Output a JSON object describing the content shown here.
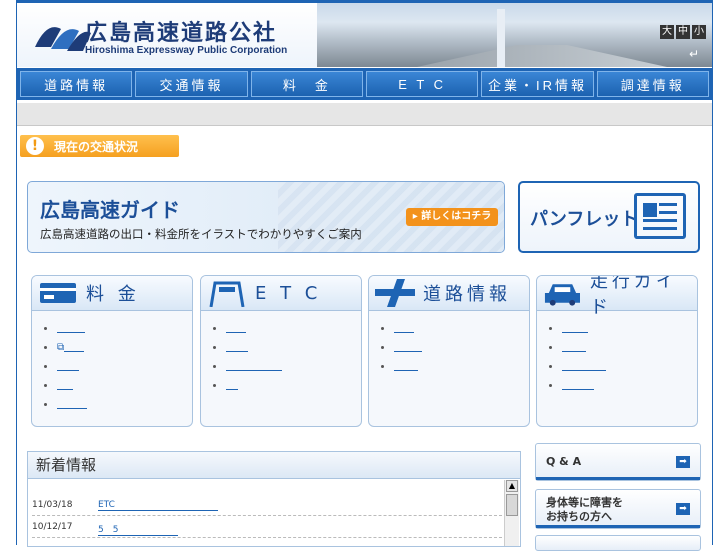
{
  "header": {
    "title_jp": "広島高速道路公社",
    "title_en": "Hiroshima Expressway Public Corporation",
    "size_controls": [
      "大",
      "中",
      "小"
    ],
    "enter_icon": "return-arrow-icon"
  },
  "nav": {
    "items": [
      "道路情報",
      "交通情報",
      "料　金",
      "E T C",
      "企業・IR情報",
      "調達情報"
    ]
  },
  "traffic": {
    "label": "現在の交通状況",
    "icon": "!"
  },
  "guide": {
    "title": "広島高速ガイド",
    "subtitle": "広島高速道路の出口・料金所をイラストでわかりやすくご案内",
    "button": "▸ 詳しくはコチラ"
  },
  "pamphlet": {
    "label": "パンフレット"
  },
  "cards": [
    {
      "title": "料 金",
      "icon": "card-icon",
      "items": 5
    },
    {
      "title": "E T C",
      "icon": "etc-gate-icon",
      "items": 4
    },
    {
      "title": "道路情報",
      "icon": "road-junction-icon",
      "items": 3
    },
    {
      "title": "走行ガイド",
      "icon": "car-icon",
      "items": 4
    }
  ],
  "news": {
    "title": "新着情報",
    "rows": [
      {
        "date": "11/03/18",
        "text": "ETC"
      },
      {
        "date": "10/12/17",
        "text": "5　5"
      }
    ]
  },
  "side": {
    "qa": "Q & A",
    "accessibility_line1": "身体等に障害を",
    "accessibility_line2": "お持ちの方へ",
    "arrow": "➡"
  }
}
